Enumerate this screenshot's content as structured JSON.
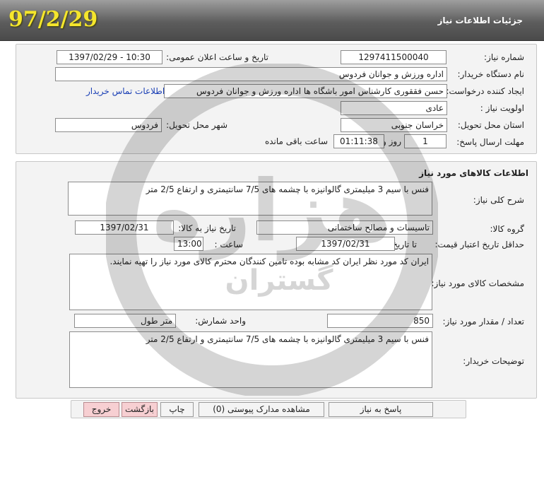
{
  "header": {
    "title": "جزئیات اطلاعات نیاز",
    "date_stamp": "97/2/29"
  },
  "need_info": {
    "need_number_label": "شماره نیاز:",
    "need_number": "1297411500040",
    "announce_label": "تاریخ و ساعت اعلان عمومی:",
    "announce_value": "1397/02/29 - 10:30",
    "buyer_org_label": "نام دستگاه خریدار:",
    "buyer_org": "اداره ورزش و جوانان فردوس",
    "creator_label": "ایجاد کننده درخواست:",
    "creator": "حسن فققوری کارشناس امور باشگاه ها اداره ورزش و جوانان فردوس",
    "contact_link": "اطلاعات تماس خریدار",
    "priority_label": "اولویت نیاز :",
    "priority": "عادی",
    "province_label": "استان محل تحویل:",
    "province": "خراسان جنوبی",
    "city_label": "شهر محل تحویل:",
    "city": "فردوس",
    "deadline_label": "مهلت ارسال پاسخ:",
    "deadline_days": "1",
    "day_and_label": "روز و",
    "deadline_time": "01:11:38",
    "remaining_label": "ساعت باقی مانده"
  },
  "goods_info": {
    "section_title": "اطلاعات کالاهای مورد نیاز",
    "general_desc_label": "شرح کلی نیاز:",
    "general_desc": "فنس با سیم 3 میلیمتری گالوانیزه با چشمه های 7/5 سانتیمتری و ارتفاع 2/5 متر",
    "goods_group_label": "گروه کالا:",
    "goods_group": "تاسیسات و مصالح ساختمانی",
    "need_date_label": "تاریخ نیاز به کالا:",
    "need_date": "1397/02/31",
    "min_validity_label": "حداقل تاریخ اعتبار قیمت:",
    "to_date_label": "تا تاریخ :",
    "to_date": "1397/02/31",
    "time_label": "ساعت :",
    "time_value": "13:00",
    "specs_label": "مشخصات کالای مورد نیاز:",
    "specs": "ایران کد مورد نظر ایران کد مشابه بوده تامین کنندگان محترم کالای مورد نیاز را تهیه نمایند.",
    "quantity_label": "تعداد / مقدار مورد نیاز:",
    "quantity": "850",
    "unit_label": "واحد شمارش:",
    "unit": "متر طول",
    "buyer_notes_label": "توضیحات خریدار:",
    "buyer_notes": "فنس با سیم 3 میلیمتری گالوانیزه با چشمه های 7/5 سانتیمتری و ارتفاع 2/5 متر"
  },
  "buttons": {
    "reply": "پاسخ به نیاز",
    "view_docs": "مشاهده مدارک پیوستی (0)",
    "print": "چاپ",
    "back": "بازگشت",
    "exit": "خروج"
  },
  "watermark": {
    "text_main": "هزاره",
    "text_sub": "گستران"
  }
}
